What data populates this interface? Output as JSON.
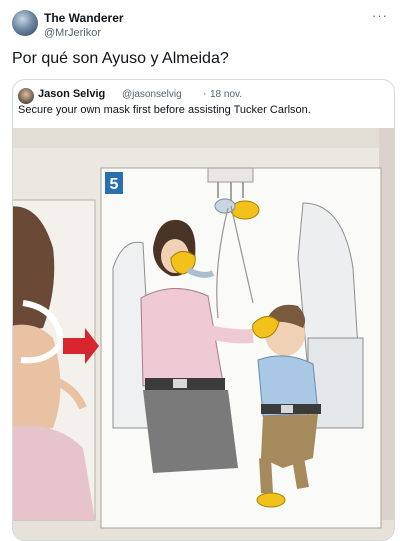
{
  "tweet": {
    "display_name": "The Wanderer",
    "handle": "@MrJerikor",
    "more_icon": "more-horizontal-icon",
    "text": "Por qué son Ayuso y Almeida?"
  },
  "quote": {
    "display_name": "Jason Selvig",
    "handle": "@jasonselvig",
    "separator": "·",
    "date": "18 nov.",
    "text": "Secure your own mask first before assisting Tucker Carlson.",
    "image": {
      "panel_number": "5"
    }
  },
  "colors": {
    "text_primary": "#0f1419",
    "text_secondary": "#536471",
    "border": "#cfd9de",
    "mask_yellow": "#f2c21a",
    "panel_number_bg": "#2a6fb0"
  }
}
